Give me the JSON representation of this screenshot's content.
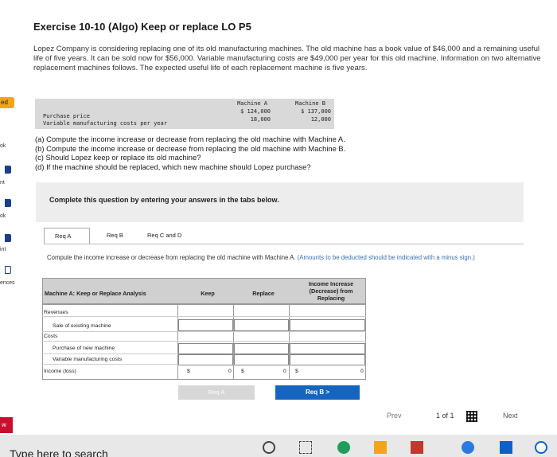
{
  "sidebar": {
    "items": [
      "ed",
      "ok",
      "nt",
      "ok",
      "int",
      "ences"
    ],
    "badge": "w"
  },
  "exercise": {
    "title": "Exercise 10-10 (Algo) Keep or replace LO P5",
    "intro": "Lopez Company is considering replacing one of its old manufacturing machines. The old machine has a book value of $46,000 and a remaining useful life of five years. It can be sold now for $56,000. Variable manufacturing costs are $49,000 per year for this old machine. Information on two alternative replacement machines follows. The expected useful life of each replacement machine is five years."
  },
  "machines": {
    "col_a": "Machine A",
    "col_b": "Machine B",
    "row1_label": "Purchase price",
    "row2_label": "Variable manufacturing costs per year",
    "a_price": "$ 124,000",
    "a_var": "18,000",
    "b_price": "$ 137,000",
    "b_var": "12,000"
  },
  "questions": {
    "a": "(a) Compute the income increase or decrease from replacing the old machine with Machine A.",
    "b": "(b) Compute the income increase or decrease from replacing the old machine with Machine B.",
    "c": "(c) Should Lopez keep or replace its old machine?",
    "d": "(d) If the machine should be replaced, which new machine should Lopez purchase?"
  },
  "instruction": "Complete this question by entering your answers in the tabs below.",
  "tabs": [
    "Req A",
    "Req B",
    "Req C and D"
  ],
  "task": {
    "main": "Compute the income increase or decrease from replacing the old machine with Machine A.",
    "hint": "(Amounts to be deducted should be indicated with a minus sign.)"
  },
  "analysis": {
    "header": "Machine A: Keep or Replace Analysis",
    "col_keep": "Keep",
    "col_replace": "Replace",
    "col_income": "Income Increase (Decrease) from Replacing",
    "rows": {
      "revenues": "Revenues",
      "sale": "Sale of existing machine",
      "costs": "Costs",
      "purchase": "Purchase of new machine",
      "variable": "Variable manufacturing costs",
      "income": "Income (loss)"
    },
    "totals": {
      "keep_sym": "$",
      "keep_val": "0",
      "replace_sym": "$",
      "replace_val": "0",
      "income_sym": "$",
      "income_val": "0"
    }
  },
  "buttons": {
    "prev": "Req A",
    "next": "Req B >"
  },
  "pager": {
    "prev": "Prev",
    "count": "1 of 1",
    "next": "Next"
  },
  "taskbar": {
    "search": "Type here to search"
  }
}
